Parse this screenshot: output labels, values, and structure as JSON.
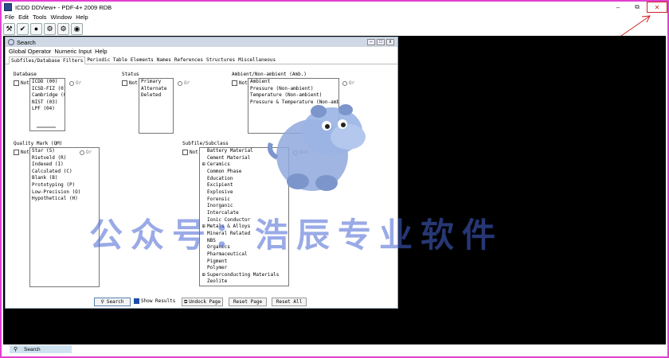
{
  "window": {
    "title": "ICDD DDView+ - PDF-4+ 2009 RDB",
    "minimize": "–",
    "restore": "⧉",
    "close": "✕"
  },
  "menubar": [
    "File",
    "Edit",
    "Tools",
    "Window",
    "Help"
  ],
  "toolbar": [
    "⚒",
    "✔",
    "●",
    "⚙",
    "⚙",
    "◉"
  ],
  "search_window": {
    "title": "Search",
    "menu": [
      "Global Operator",
      "Numeric Input",
      "Help"
    ],
    "tabs": [
      "Subfiles/Database Filters",
      "Periodic Table",
      "Elements",
      "Names",
      "References",
      "Structures",
      "Miscellaneous"
    ],
    "database": {
      "label": "Database",
      "not": "Not",
      "or": "Or",
      "items": [
        "ICDD (00)",
        "ICSD-FIZ (01)",
        "Cambridge (02",
        "NIST (03)",
        "LPF (04)"
      ]
    },
    "status": {
      "label": "Status",
      "not": "Not",
      "or": "Or",
      "items": [
        "Primary",
        "Alternate",
        "Deleted"
      ]
    },
    "ambient": {
      "label": "Ambient/Non-ambient (Amb.)",
      "not": "Not",
      "or": "Or",
      "items": [
        "Ambient",
        "Pressure (Non-ambient)",
        "Temperature (Non-ambient)",
        "Pressure & Temperature (Non-ambient)"
      ]
    },
    "quality": {
      "label": "Quality Mark (QM)",
      "not": "Not",
      "or": "Or",
      "items": [
        "Star (S)",
        "Rietveld (R)",
        "Indexed (I)",
        "Calculated (C)",
        "Blank (B)",
        "Prototyping (P)",
        "Low-Precision (O)",
        "Hypothetical (H)"
      ]
    },
    "subfile": {
      "label": "Subfile/Subclass",
      "not": "Not",
      "and": "And",
      "items": [
        "Battery Material",
        "Cement Material",
        "Ceramics",
        "Common Phase",
        "Education",
        "Excipient",
        "Explosive",
        "Forensic",
        "Inorganic",
        "Intercalate",
        "Ionic Conductor",
        "Metals & Alloys",
        "Mineral Related",
        "NBS",
        "Organics",
        "Pharmaceutical",
        "Pigment",
        "Polymer",
        "Superconducting Materials",
        "Zeolite"
      ]
    },
    "buttons": {
      "search": "Search",
      "show_results": "Show Results",
      "undock": "Undock Page",
      "reset_page": "Reset Page",
      "reset_all": "Reset All"
    }
  },
  "statusbar": {
    "tab": "Search"
  },
  "watermark": "公众号：浩辰专业软件",
  "colors": {
    "frame": "#e040d0",
    "workspace": "#000000",
    "watermark": "#4664d2",
    "close_highlight": "#d02020"
  }
}
